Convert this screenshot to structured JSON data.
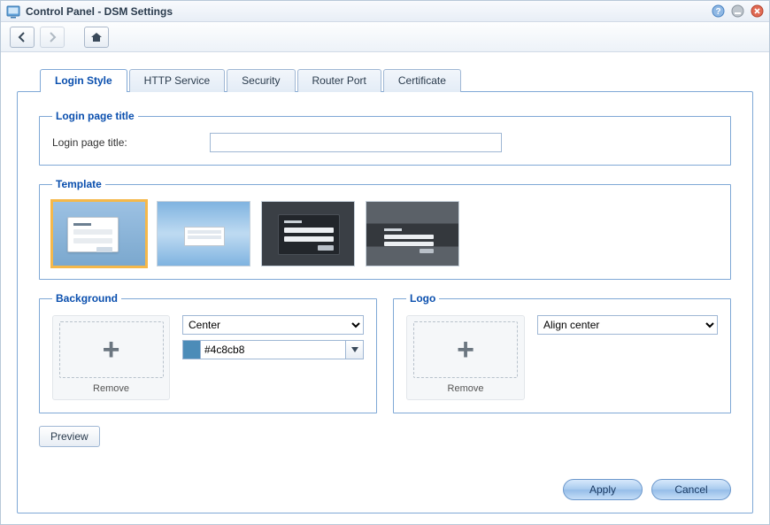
{
  "window": {
    "title": "Control Panel - DSM Settings"
  },
  "tabs": [
    {
      "label": "Login Style",
      "active": true
    },
    {
      "label": "HTTP Service",
      "active": false
    },
    {
      "label": "Security",
      "active": false
    },
    {
      "label": "Router Port",
      "active": false
    },
    {
      "label": "Certificate",
      "active": false
    }
  ],
  "login_title_section": {
    "legend": "Login page title",
    "field_label": "Login page title:",
    "value": ""
  },
  "template_section": {
    "legend": "Template",
    "selected_index": 0
  },
  "background_section": {
    "legend": "Background",
    "remove_label": "Remove",
    "position_options": [
      "Center"
    ],
    "position_value": "Center",
    "color_value": "#4c8cb8"
  },
  "logo_section": {
    "legend": "Logo",
    "remove_label": "Remove",
    "align_options": [
      "Align center"
    ],
    "align_value": "Align center"
  },
  "buttons": {
    "preview": "Preview",
    "apply": "Apply",
    "cancel": "Cancel"
  },
  "icons": {
    "help": "help-icon",
    "minimize": "minimize-icon",
    "close": "close-icon",
    "back": "back-icon",
    "forward": "forward-icon",
    "home": "home-icon"
  }
}
